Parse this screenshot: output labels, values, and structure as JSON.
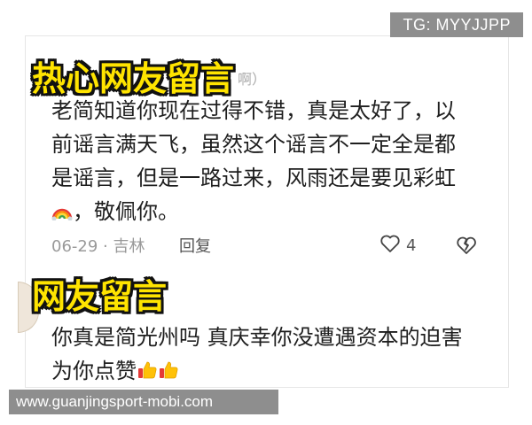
{
  "watermark_top": "TG: MYYJJPP",
  "banner1": "热心网友留言",
  "hidden_name_suffix": "啊）",
  "comment1": {
    "text_main": "老简知道你现在过得不错，真是太好了，以前谣言满天飞，虽然这个谣言不一定全是都是谣言，但是一路过来，风雨还是要见彩虹",
    "text_end": "，敬佩你。",
    "emoji": "rainbow-emoji",
    "date_location": "06-29 · 吉林",
    "reply_label": "回复",
    "like_count": "4"
  },
  "banner2": "网友留言",
  "comment2": {
    "text": "你真是简光州吗 真庆幸你没遭遇资本的迫害 为你点赞",
    "emoji": "thumbs-up-emoji"
  },
  "watermark_bottom": "www.guanjingsport-mobi.com",
  "colors": {
    "banner_fill": "#ffe400",
    "banner_stroke": "#111111",
    "watermark_bg": "#8e8e8e",
    "meta_text": "#999999"
  }
}
